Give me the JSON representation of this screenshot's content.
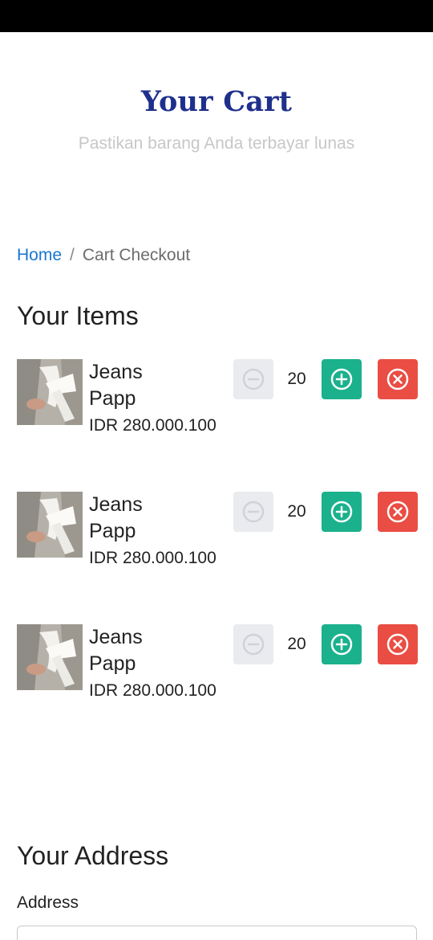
{
  "hero": {
    "title": "Your Cart",
    "subtitle": "Pastikan barang Anda terbayar lunas"
  },
  "breadcrumb": {
    "home": "Home",
    "separator": "/",
    "current": "Cart Checkout"
  },
  "items_section": {
    "title": "Your Items",
    "items": [
      {
        "name": "Jeans Papp",
        "price": "IDR 280.000.100",
        "quantity": "20"
      },
      {
        "name": "Jeans Papp",
        "price": "IDR 280.000.100",
        "quantity": "20"
      },
      {
        "name": "Jeans Papp",
        "price": "IDR 280.000.100",
        "quantity": "20"
      }
    ]
  },
  "address_section": {
    "title": "Your Address",
    "address_label": "Address",
    "address_value": ""
  },
  "colors": {
    "title": "#1f2f8c",
    "link": "#1976d2",
    "plus_button": "#1bb18d",
    "remove_button": "#ea4d43",
    "minus_button_disabled": "#e9ebef"
  },
  "icons": {
    "minus": "minus-circle-icon",
    "plus": "plus-circle-icon",
    "remove": "close-circle-icon"
  }
}
